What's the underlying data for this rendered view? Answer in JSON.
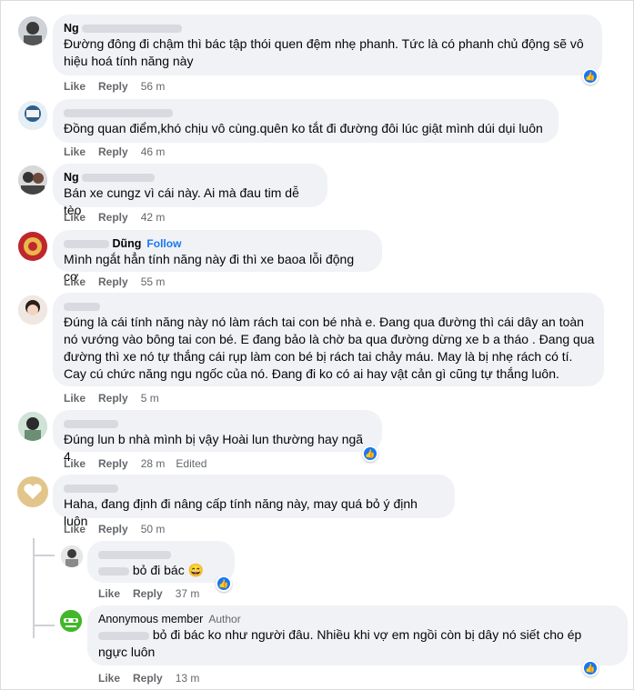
{
  "actions": {
    "like": "Like",
    "reply": "Reply"
  },
  "comments": [
    {
      "name": "Ng",
      "text": "Đường đông đi chậm thì bác tập thói quen đệm nhẹ phanh. Tức là có phanh chủ động sẽ vô hiệu hoá tính năng này",
      "time": "56 m"
    },
    {
      "name": "",
      "text": "Đồng quan điểm,khó chịu vô cùng.quên ko tắt đi đường đôi lúc giật mình dúi dụi luôn",
      "time": "46 m"
    },
    {
      "name": "Ng",
      "text": "Bán xe cungz vì cái này. Ai mà đau tim dễ tèo",
      "time": "42 m"
    },
    {
      "name": "Dũng",
      "follow": "Follow",
      "text": "Mình ngắt hẳn tính năng này đi thì xe baoa lỗi động cơ",
      "time": "55 m"
    },
    {
      "name": "",
      "text": "Đúng là cái tính năng này nó làm rách tai con bé nhà e. Đang qua đường thì cái dây an toàn nó vướng vào bông tai con bé. E đang bảo là chờ ba qua đường dừng xe b a tháo . Đang qua đường thì xe nó tự thắng cái rụp làm con bé bị rách tai chảy máu. May là bị nhẹ rách có tí. Cay cú chức năng ngu ngốc của nó. Đang đi ko có ai hay vật cản gì cũng tự thắng luôn.",
      "time": "5 m"
    },
    {
      "name": "",
      "text": "Đúng lun b nhà mình bị vậy Hoài lun thường hay ngã 4",
      "time": "28 m",
      "edited": "Edited"
    },
    {
      "name": "",
      "text": "Haha, đang định đi nâng cấp tính năng này, may quá bỏ ý định luôn",
      "time": "50 m"
    }
  ],
  "replies": [
    {
      "name": "",
      "text": "bỏ đi bác 😄",
      "time": "37 m"
    },
    {
      "name": "Anonymous member",
      "badge": "Author",
      "text1": "bỏ đi bác ko như người đâu. Nhiều khi vợ em ngồi còn bị dây nó siết cho ép",
      "text2": "ngực luôn",
      "time": "13 m"
    }
  ],
  "colors": {
    "bubble": "#f0f2f5",
    "meta": "#65676b",
    "accent": "#1877f2",
    "text": "#050505"
  },
  "icons": {
    "reaction": "like-thumb-icon"
  }
}
